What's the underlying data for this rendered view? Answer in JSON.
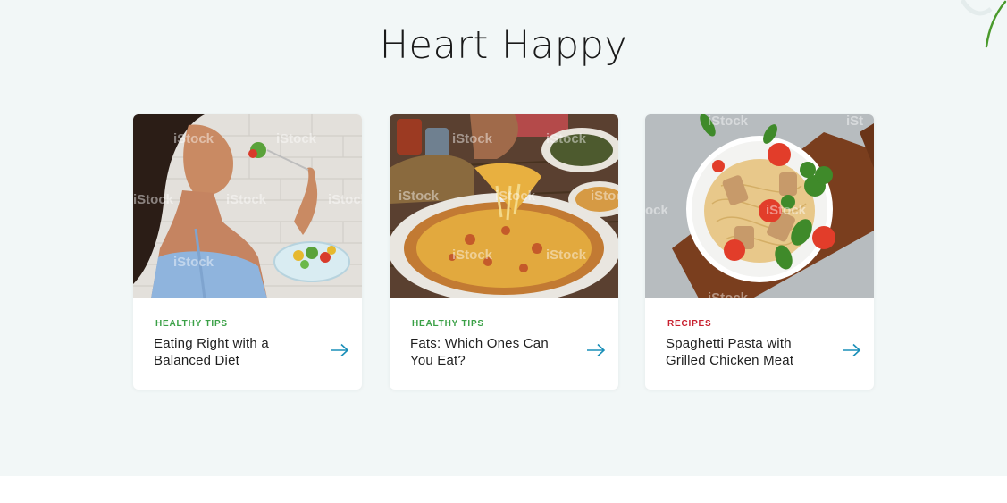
{
  "section": {
    "title": "Heart Happy",
    "background": "#f2f7f7"
  },
  "cards": [
    {
      "tag": "Healthy Tips",
      "tag_color": "#3aa046",
      "title": "Eating Right with a Balanced Diet",
      "image_icon": "woman-eating-salad-photo",
      "arrow_icon": "arrow-right-icon"
    },
    {
      "tag": "Healthy Tips",
      "tag_color": "#3aa046",
      "title": "Fats: Which Ones Can You Eat?",
      "image_icon": "pizza-photo",
      "arrow_icon": "arrow-right-icon"
    },
    {
      "tag": "Recipes",
      "tag_color": "#c8202f",
      "title": "Spaghetti Pasta with Grilled Chicken Meat",
      "image_icon": "pasta-chicken-photo",
      "arrow_icon": "arrow-right-icon"
    }
  ],
  "colors": {
    "arrow": "#1a8fb8",
    "title_text": "#1a1a1a"
  }
}
